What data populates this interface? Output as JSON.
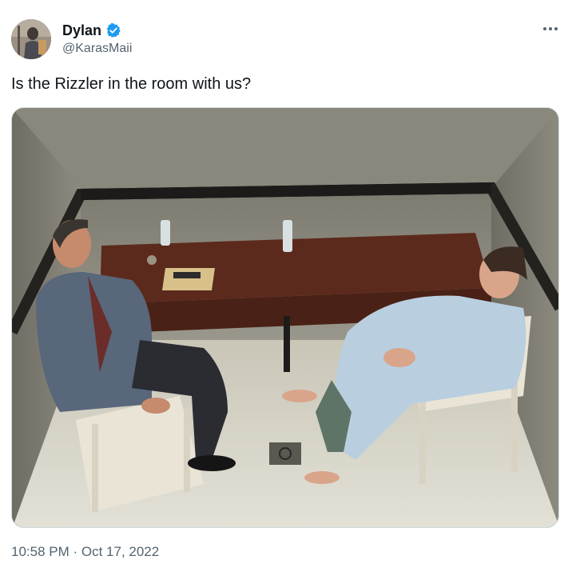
{
  "author": {
    "display_name": "Dylan",
    "handle": "@KarasMaii",
    "verified": true
  },
  "tweet": {
    "text": "Is the Rizzler in the room with us?",
    "timestamp": "10:58 PM · Oct 17, 2022"
  },
  "icons": {
    "verified": "verified-badge-icon",
    "more": "more-options-icon"
  },
  "colors": {
    "verified_badge": "#1d9bf0",
    "secondary_text": "#536471",
    "primary_text": "#0f1419"
  }
}
